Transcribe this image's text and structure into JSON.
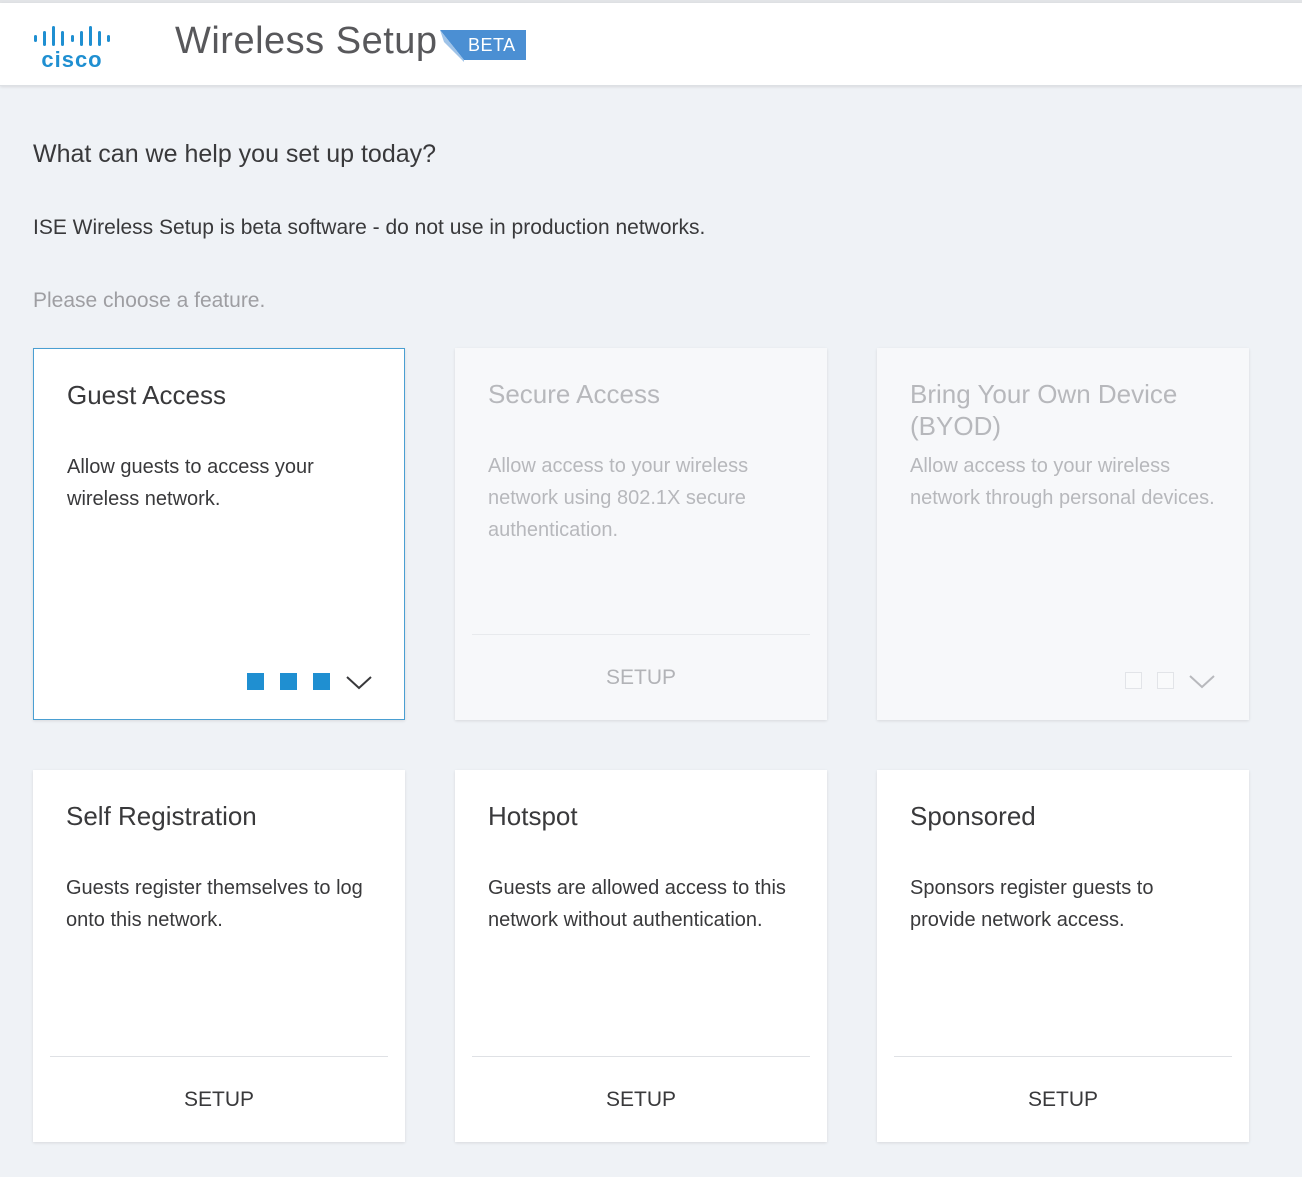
{
  "header": {
    "logo_text": "cisco",
    "app_title": "Wireless Setup",
    "badge": "BETA"
  },
  "intro": {
    "question": "What can we help you set up today?",
    "warning": "ISE Wireless Setup is beta software - do not use in production networks.",
    "prompt": "Please choose a feature."
  },
  "colors": {
    "page_background": "#eff2f6",
    "brand_blue": "#1f8fd1",
    "selected_border": "#4a9fd2",
    "beta_badge": "#4b8fd3",
    "disabled_text": "#b7b8bc"
  },
  "cards": [
    {
      "title": "Guest Access",
      "description": "Allow guests to access your wireless network.",
      "state": "selected",
      "progress": {
        "filled": 3,
        "total": 3
      },
      "toggle_icon": "chevron-down-icon"
    },
    {
      "title": "Secure Access",
      "description": "Allow access to your wireless network using 802.1X secure authentication.",
      "state": "disabled",
      "action": "SETUP"
    },
    {
      "title": "Bring Your Own Device (BYOD)",
      "description": "Allow access to your wireless network through personal devices.",
      "state": "disabled",
      "progress": {
        "filled": 0,
        "total": 2
      },
      "toggle_icon": "chevron-down-icon"
    },
    {
      "title": "Self Registration",
      "description": "Guests register themselves to log onto this network.",
      "state": "enabled",
      "action": "SETUP"
    },
    {
      "title": "Hotspot",
      "description": "Guests are allowed access to this network without authentication.",
      "state": "enabled",
      "action": "SETUP"
    },
    {
      "title": "Sponsored",
      "description": "Sponsors register guests to provide network access.",
      "state": "enabled",
      "action": "SETUP"
    }
  ]
}
